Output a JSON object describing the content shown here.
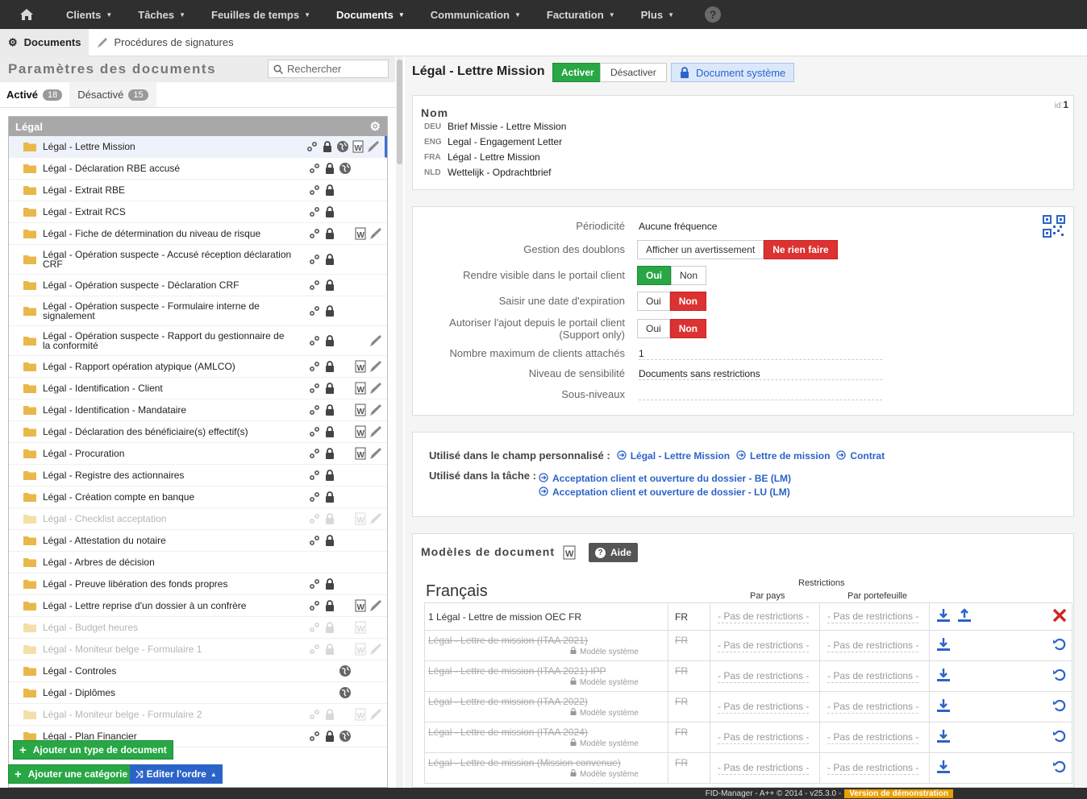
{
  "nav": {
    "items": [
      {
        "label": "Clients",
        "active": false
      },
      {
        "label": "Tâches",
        "active": false
      },
      {
        "label": "Feuilles de temps",
        "active": false
      },
      {
        "label": "Documents",
        "active": true
      },
      {
        "label": "Communication",
        "active": false
      },
      {
        "label": "Facturation",
        "active": false
      },
      {
        "label": "Plus",
        "active": false
      }
    ],
    "help": "?"
  },
  "subnav": {
    "tab1": "Documents",
    "tab2": "Procédures de signatures"
  },
  "left": {
    "title": "Paramètres des documents",
    "search_placeholder": "Rechercher",
    "tab_active": "Activé",
    "tab_active_count": "18",
    "tab_inactive": "Désactivé",
    "tab_inactive_count": "15",
    "category": "Légal",
    "rows": [
      {
        "label": "Légal - Lettre Mission",
        "disabled": false,
        "icons": [
          "gears",
          "lock",
          "globe",
          "word",
          "pen"
        ]
      },
      {
        "label": "Légal - Déclaration RBE accusé",
        "disabled": false,
        "icons": [
          "gears",
          "lock",
          "globe"
        ]
      },
      {
        "label": "Légal - Extrait RBE",
        "disabled": false,
        "icons": [
          "gears",
          "lock"
        ]
      },
      {
        "label": "Légal - Extrait RCS",
        "disabled": false,
        "icons": [
          "gears",
          "lock"
        ]
      },
      {
        "label": "Légal - Fiche de détermination du niveau de risque",
        "disabled": false,
        "icons": [
          "gears",
          "lock",
          "",
          "word",
          "pen"
        ]
      },
      {
        "label": "Légal - Opération suspecte - Accusé réception déclaration CRF",
        "disabled": false,
        "icons": [
          "gears",
          "lock"
        ]
      },
      {
        "label": "Légal - Opération suspecte - Déclaration CRF",
        "disabled": false,
        "icons": [
          "gears",
          "lock"
        ]
      },
      {
        "label": "Légal - Opération suspecte - Formulaire interne de signalement",
        "disabled": false,
        "icons": [
          "gears",
          "lock"
        ]
      },
      {
        "label": "Légal - Opération suspecte - Rapport du gestionnaire de la conformité",
        "disabled": false,
        "icons": [
          "gears",
          "lock",
          "",
          "",
          "pen"
        ]
      },
      {
        "label": "Légal - Rapport opération atypique (AMLCO)",
        "disabled": false,
        "icons": [
          "gears",
          "lock",
          "",
          "word",
          "pen"
        ]
      },
      {
        "label": "Légal - Identification - Client",
        "disabled": false,
        "icons": [
          "gears",
          "lock",
          "",
          "word",
          "pen"
        ]
      },
      {
        "label": "Légal - Identification - Mandataire",
        "disabled": false,
        "icons": [
          "gears",
          "lock",
          "",
          "word",
          "pen"
        ]
      },
      {
        "label": "Légal - Déclaration des bénéficiaire(s) effectif(s)",
        "disabled": false,
        "icons": [
          "gears",
          "lock",
          "",
          "word",
          "pen"
        ]
      },
      {
        "label": "Légal - Procuration",
        "disabled": false,
        "icons": [
          "gears",
          "lock",
          "",
          "word",
          "pen"
        ]
      },
      {
        "label": "Légal - Registre des actionnaires",
        "disabled": false,
        "icons": [
          "gears",
          "lock"
        ]
      },
      {
        "label": "Légal - Création compte en banque",
        "disabled": false,
        "icons": [
          "gears",
          "lock"
        ]
      },
      {
        "label": "Légal - Checklist acceptation",
        "disabled": true,
        "icons": [
          "gears",
          "lock",
          "",
          "word",
          "pen"
        ]
      },
      {
        "label": "Légal - Attestation du notaire",
        "disabled": false,
        "icons": [
          "gears",
          "lock"
        ]
      },
      {
        "label": "Légal - Arbres de décision",
        "disabled": false,
        "icons": []
      },
      {
        "label": "Légal - Preuve libération des fonds propres",
        "disabled": false,
        "icons": [
          "gears",
          "lock"
        ]
      },
      {
        "label": "Légal - Lettre reprise d'un dossier à un confrère",
        "disabled": false,
        "icons": [
          "gears",
          "lock",
          "",
          "word",
          "pen"
        ]
      },
      {
        "label": "Légal - Budget heures",
        "disabled": true,
        "icons": [
          "gears",
          "lock",
          "",
          "word"
        ]
      },
      {
        "label": "Légal - Moniteur belge - Formulaire 1",
        "disabled": true,
        "icons": [
          "gears",
          "lock",
          "",
          "word",
          "pen"
        ]
      },
      {
        "label": "Légal - Controles",
        "disabled": false,
        "icons": [
          "",
          "",
          "globe"
        ]
      },
      {
        "label": "Légal - Diplômes",
        "disabled": false,
        "icons": [
          "",
          "",
          "globe"
        ]
      },
      {
        "label": "Légal - Moniteur belge - Formulaire 2",
        "disabled": true,
        "icons": [
          "gears",
          "lock",
          "",
          "word",
          "pen"
        ]
      },
      {
        "label": "Légal - Plan Financier",
        "disabled": false,
        "icons": [
          "gears",
          "lock",
          "globe"
        ]
      }
    ],
    "btn_add_type": "Ajouter un type de document",
    "btn_add_cat": "Ajouter une catégorie",
    "btn_order": "Editer l'ordre"
  },
  "right": {
    "title": "Légal - Lettre Mission",
    "btn_activate": "Activer",
    "btn_deactivate": "Désactiver",
    "btn_system": "Document système",
    "id_label": "id:",
    "id_value": "1",
    "name_title": "Nom",
    "names": [
      {
        "lang": "DEU",
        "value": "Brief Missie - Lettre Mission"
      },
      {
        "lang": "ENG",
        "value": "Legal - Engagement Letter"
      },
      {
        "lang": "FRA",
        "value": "Légal - Lettre Mission"
      },
      {
        "lang": "NLD",
        "value": "Wettelijk - Opdrachtbrief"
      }
    ],
    "props": {
      "periodicity_label": "Périodicité",
      "periodicity_value": "Aucune fréquence",
      "dup_label": "Gestion des doublons",
      "dup_opt1": "Afficher un avertissement",
      "dup_opt2": "Ne rien faire",
      "portal_label": "Rendre visible dans le portail client",
      "expiry_label": "Saisir une date d'expiration",
      "allow_label1": "Autoriser l'ajout depuis le portail client",
      "allow_label2": "(Support only)",
      "yes": "Oui",
      "no": "Non",
      "max_label": "Nombre maximum de clients attachés",
      "max_value": "1",
      "sens_label": "Niveau de sensibilité",
      "sens_value": "Documents sans restrictions",
      "sub_label": "Sous-niveaux"
    },
    "usage": {
      "field_label": "Utilisé dans le champ personnalisé :",
      "field_links": [
        "Légal - Lettre Mission",
        "Lettre de mission",
        "Contrat"
      ],
      "task_label": "Utilisé dans la tâche :",
      "task_links": [
        "Acceptation client et ouverture du dossier - BE (LM)",
        "Acceptation client et ouverture de dossier - LU (LM)"
      ]
    },
    "models": {
      "title": "Modèles de document",
      "help_btn": "Aide",
      "lang_title": "Français",
      "restrictions": "Restrictions",
      "by_country": "Par pays",
      "by_portfolio": "Par portefeuille",
      "no_restrictions": "- Pas de restrictions -",
      "system_model": "Modèle système",
      "rows": [
        {
          "name": "1 Légal - Lettre de mission OEC FR",
          "lang": "FR",
          "struck": false
        },
        {
          "name": "Légal - Lettre de mission (ITAA 2021)",
          "lang": "FR",
          "struck": true
        },
        {
          "name": "Légal - Lettre de mission (ITAA 2021) IPP",
          "lang": "FR",
          "struck": true
        },
        {
          "name": "Légal - Lettre de mission (ITAA 2022)",
          "lang": "FR",
          "struck": true
        },
        {
          "name": "Légal - Lettre de mission (ITAA 2024)",
          "lang": "FR",
          "struck": true
        },
        {
          "name": "Légal - Lettre de mission (Mission convenue)",
          "lang": "FR",
          "struck": true
        }
      ]
    }
  },
  "footer": {
    "text": "FID-Manager - A++ © 2014 - v25.3.0 -",
    "demo": "Version de démonstration"
  },
  "colors": {
    "green": "#28a745",
    "red": "#dc3232",
    "blue": "#2c63c9",
    "topbar": "#2f2f2f"
  }
}
